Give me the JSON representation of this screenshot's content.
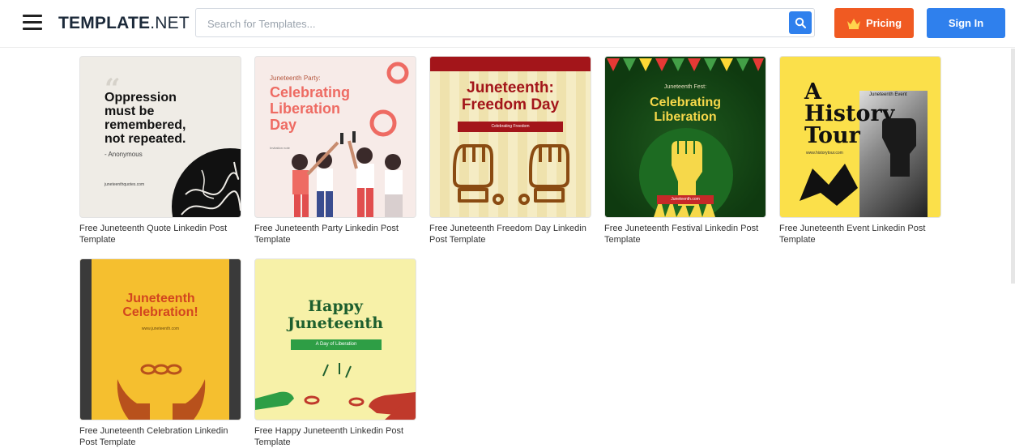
{
  "header": {
    "logo_bold": "TEMPLATE",
    "logo_thin": ".NET",
    "search_placeholder": "Search for Templates...",
    "pricing_label": "Pricing",
    "signin_label": "Sign In"
  },
  "colors": {
    "brand_orange": "#f05a22",
    "brand_blue": "#2f80ed"
  },
  "cards": [
    {
      "caption": "Free Juneteenth Quote Linkedin Post Template",
      "quote_line1": "Oppression",
      "quote_line2": "must be",
      "quote_line3": "remembered,",
      "quote_line4": "not repeated.",
      "author": "- Anonymous",
      "site": "juneteenthquotes.com"
    },
    {
      "caption": "Free Juneteenth Party Linkedin Post Template",
      "kicker": "Juneteenth Party:",
      "line1": "Celebrating",
      "line2": "Liberation",
      "line3": "Day",
      "small": "Invitation note"
    },
    {
      "caption": "Free Juneteenth Freedom Day Linkedin Post Template",
      "line1": "Juneteenth:",
      "line2": "Freedom Day",
      "banner": "Celebrating Freedom"
    },
    {
      "caption": "Free Juneteenth Festival Linkedin Post Template",
      "kicker": "Juneteenth Fest:",
      "line1": "Celebrating",
      "line2": "Liberation",
      "banner": "Juneteenth.com"
    },
    {
      "caption": "Free Juneteenth Event Linkedin Post Template",
      "kicker": "Juneteenth Event",
      "line1": "A",
      "line2": "History",
      "line3": "Tour",
      "site": "www.historytour.com"
    },
    {
      "caption": "Free Juneteenth Celebration Linkedin Post Template",
      "line1": "Juneteenth",
      "line2": "Celebration!",
      "site": "www.juneteenth.com"
    },
    {
      "caption": "Free Happy Juneteenth Linkedin Post Template",
      "line1": "Happy",
      "line2": "Juneteenth",
      "banner": "A Day of Liberation"
    }
  ]
}
